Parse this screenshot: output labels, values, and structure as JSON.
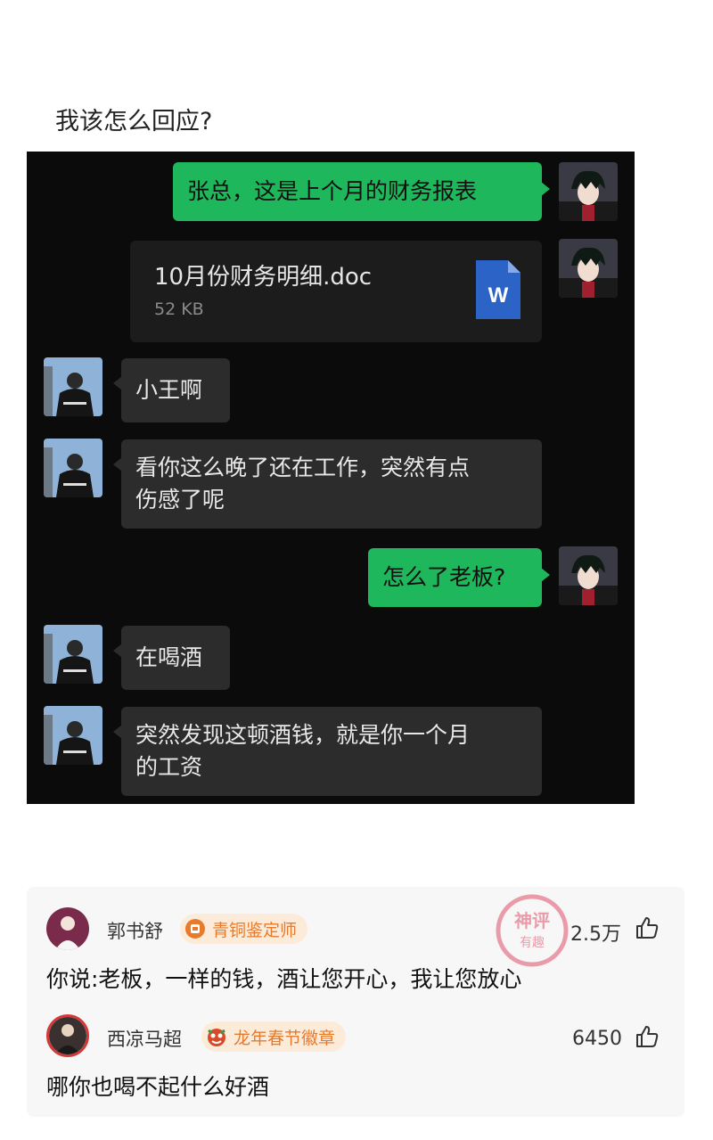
{
  "post": {
    "title": "我该怎么回应?"
  },
  "chat": {
    "messages": [
      {
        "from": "me",
        "text": "张总，这是上个月的财务报表"
      },
      {
        "from": "me",
        "type": "file",
        "file_name": "10月份财务明细.doc",
        "file_size": "52 KB",
        "file_icon_label": "W"
      },
      {
        "from": "boss",
        "text": "小王啊"
      },
      {
        "from": "boss",
        "line1": "看你这么晚了还在工作，突然有点",
        "line2": "伤感了呢"
      },
      {
        "from": "me",
        "text": "怎么了老板?"
      },
      {
        "from": "boss",
        "text": "在喝酒"
      },
      {
        "from": "boss",
        "line1": "突然发现这顿酒钱，就是你一个月",
        "line2": "的工资"
      }
    ]
  },
  "comments": [
    {
      "name": "郭书舒",
      "badge": "青铜鉴定师",
      "badge_icon": "bronze-medal-icon",
      "badge_color": "#e87a2c",
      "likes": "2.5万",
      "text": "你说:老板，一样的钱，酒让您开心，我让您放心"
    },
    {
      "name": "西凉马超",
      "badge": "龙年春节徽章",
      "badge_icon": "lion-dance-icon",
      "badge_color": "#e87a2c",
      "likes": "6450",
      "text": "哪你也喝不起什么好酒"
    }
  ],
  "stamp": {
    "line1": "神评",
    "line2": "有趣"
  },
  "colors": {
    "my_bubble": "#1fb75b",
    "their_bubble": "#2c2c2c",
    "chat_bg": "#0b0b0b"
  }
}
